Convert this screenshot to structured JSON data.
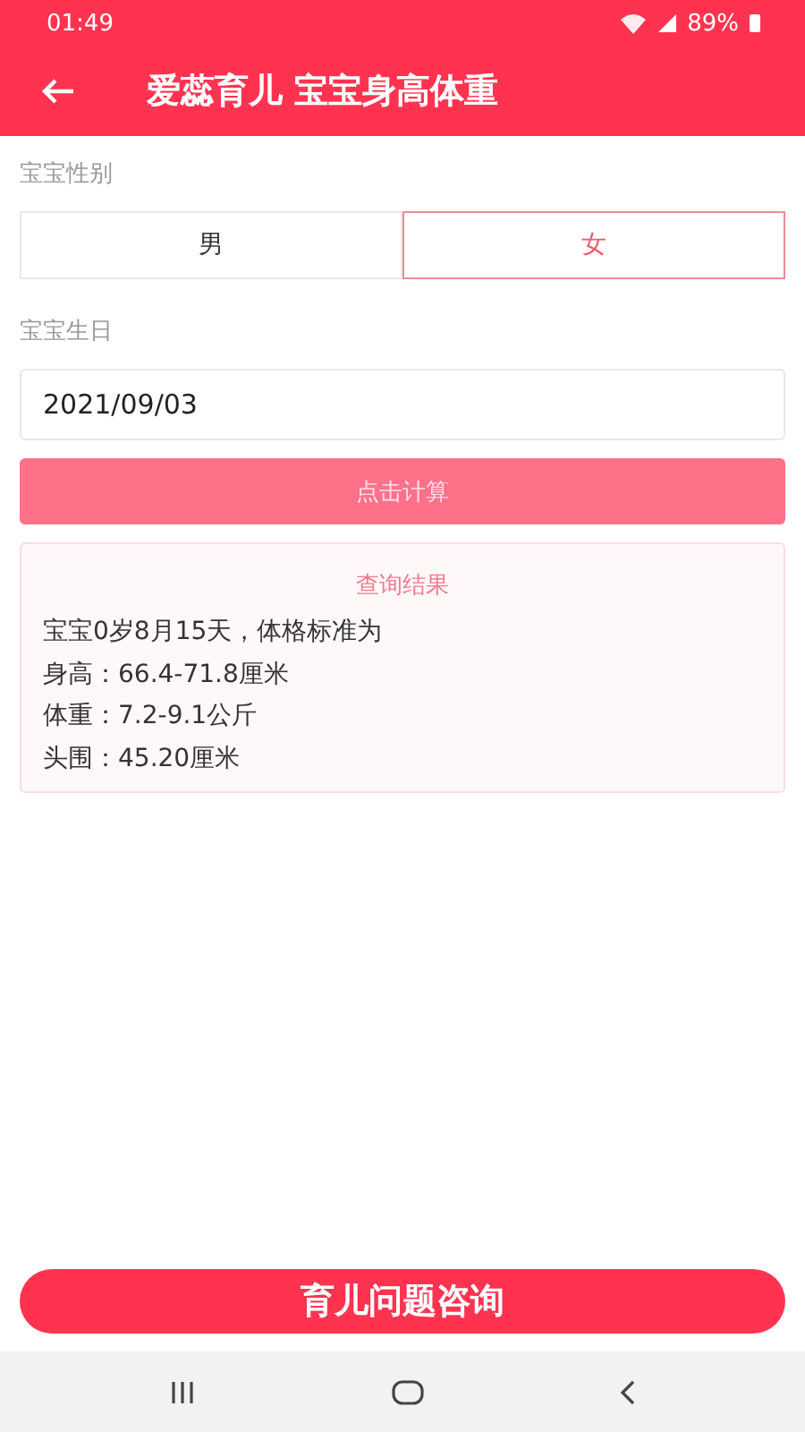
{
  "status_bar": {
    "time": "01:49",
    "battery": "89%"
  },
  "header": {
    "title": "爱蕊育儿 宝宝身高体重"
  },
  "gender": {
    "label": "宝宝性别",
    "options": [
      {
        "label": "男",
        "selected": false
      },
      {
        "label": "女",
        "selected": true
      }
    ]
  },
  "birthday": {
    "label": "宝宝生日",
    "value": "2021/09/03"
  },
  "calculate_button": "点击计算",
  "result": {
    "title": "查询结果",
    "lines": [
      "宝宝0岁8月15天，体格标准为",
      "身高：66.4-71.8厘米",
      "体重：7.2-9.1公斤",
      "头围：45.20厘米"
    ]
  },
  "consult_button": "育儿问题咨询"
}
